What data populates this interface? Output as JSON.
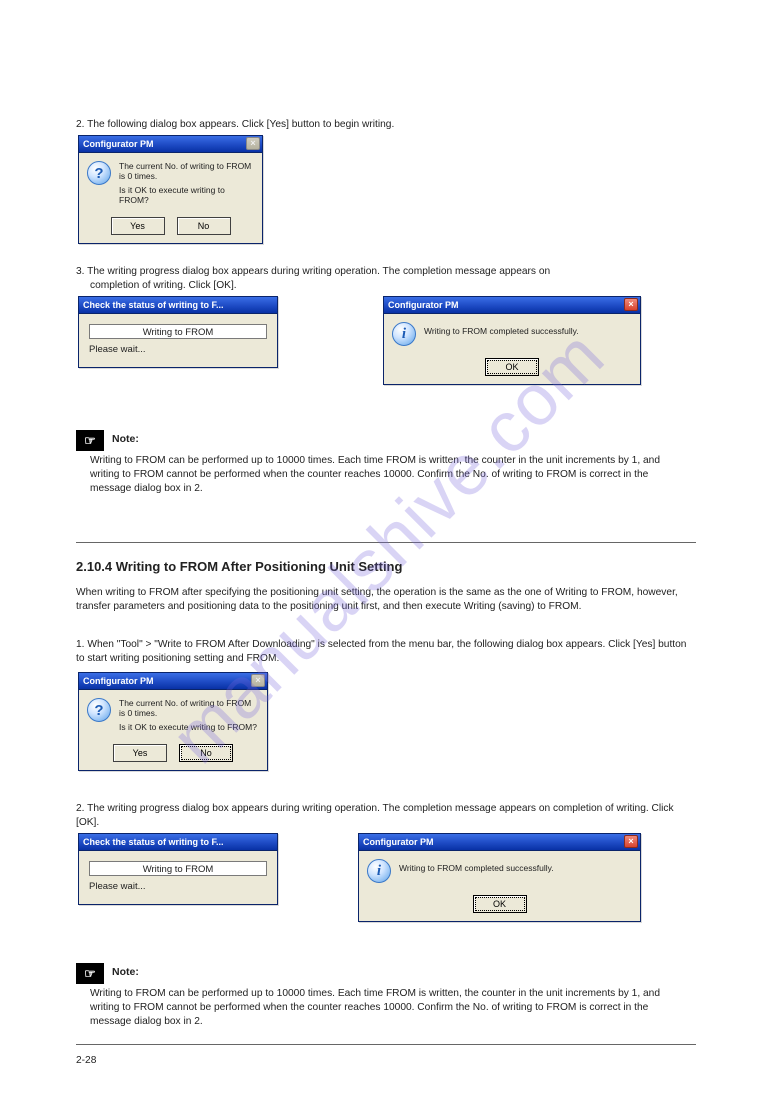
{
  "watermark": "manualshive.com",
  "step2": "2. The following dialog box appears. Click [Yes] button to begin writing.",
  "confirm_dialog": {
    "title": "Configurator PM",
    "line1": "The current No. of writing to FROM is 0 times.",
    "line2": "Is it OK to execute writing to FROM?",
    "yes": "Yes",
    "no": "No"
  },
  "step3": "3. The writing progress dialog box appears during writing operation. The completion message appears on",
  "step3b": "completion of writing. Click [OK].",
  "progress_dialog": {
    "title": "Check the status of writing to F...",
    "bar_label": "Writing to FROM",
    "wait": "Please wait..."
  },
  "complete_dialog": {
    "title": "Configurator PM",
    "msg": "Writing to FROM completed successfully.",
    "ok": "OK"
  },
  "note_label": "Note:",
  "note_body": "Writing to FROM can be performed up to 10000 times. Each time FROM is written, the counter in the unit increments by 1, and writing to FROM cannot be performed when the counter reaches 10000. Confirm the No. of writing to FROM is correct in the message dialog box in 2.",
  "section_title": "2.10.4 Writing to FROM After Positioning Unit Setting",
  "section_intro": "When writing to FROM after specifying the positioning unit setting, the operation is the same as the one of Writing to FROM, however, transfer parameters and positioning data to the positioning unit first, and then execute Writing (saving) to FROM.",
  "lower_step1": "1. When \"Tool\" > \"Write to FROM After Downloading\" is selected from the menu bar, the following dialog box appears. Click [Yes] button to start writing positioning setting and FROM.",
  "lower_step2": "2. The writing progress dialog box appears during writing operation. The completion message appears on completion of writing. Click [OK].",
  "footer_page": "2-28"
}
